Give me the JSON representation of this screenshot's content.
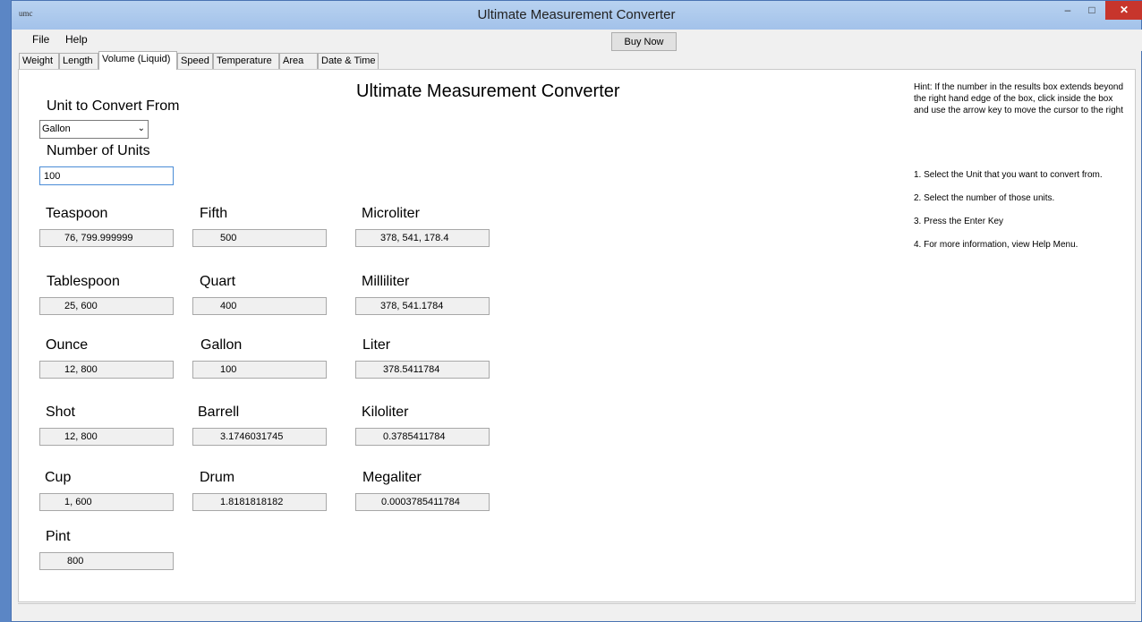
{
  "window": {
    "app_icon_text": "umc",
    "title": "Ultimate Measurement Converter",
    "minimize": "–",
    "maximize": "□",
    "close": "✕"
  },
  "menu": {
    "file": "File",
    "help": "Help",
    "buy_now": "Buy Now"
  },
  "tabs": [
    {
      "label": "Weight",
      "active": false
    },
    {
      "label": "Length",
      "active": false
    },
    {
      "label": "Volume (Liquid)",
      "active": true
    },
    {
      "label": "Speed",
      "active": false
    },
    {
      "label": "Temperature",
      "active": false
    },
    {
      "label": "Area",
      "active": false
    },
    {
      "label": "Date & Time",
      "active": false
    }
  ],
  "main": {
    "heading": "Ultimate Measurement Converter",
    "unit_from_label": "Unit to Convert From",
    "unit_from_value": "Gallon",
    "num_units_label": "Number of Units",
    "num_units_value": "100"
  },
  "results": {
    "col1": [
      {
        "label": "Teaspoon",
        "value": "76, 799.999999"
      },
      {
        "label": "Tablespoon",
        "value": "25, 600"
      },
      {
        "label": "Ounce",
        "value": "12, 800"
      },
      {
        "label": "Shot",
        "value": "12, 800"
      },
      {
        "label": "Cup",
        "value": "1, 600"
      },
      {
        "label": "Pint",
        "value": "800"
      }
    ],
    "col2": [
      {
        "label": "Fifth",
        "value": "500"
      },
      {
        "label": "Quart",
        "value": "400"
      },
      {
        "label": "Gallon",
        "value": "100"
      },
      {
        "label": "Barrell",
        "value": "3.1746031745"
      },
      {
        "label": "Drum",
        "value": "1.8181818182"
      }
    ],
    "col3": [
      {
        "label": "Microliter",
        "value": "378, 541, 178.4"
      },
      {
        "label": "Milliliter",
        "value": "378, 541.1784"
      },
      {
        "label": "Liter",
        "value": "378.5411784"
      },
      {
        "label": "Kiloliter",
        "value": "0.3785411784"
      },
      {
        "label": "Megaliter",
        "value": "0.0003785411784"
      }
    ]
  },
  "hint": {
    "line1": "Hint: If the number in the results box extends beyond",
    "line2": "the right hand edge of the box, click inside the box",
    "line3": "and use the arrow key to move the cursor to the right"
  },
  "steps": [
    "1. Select the Unit that you want to convert from.",
    "2. Select the number of those units.",
    "3. Press the Enter Key",
    "4. For more information, view Help Menu."
  ]
}
